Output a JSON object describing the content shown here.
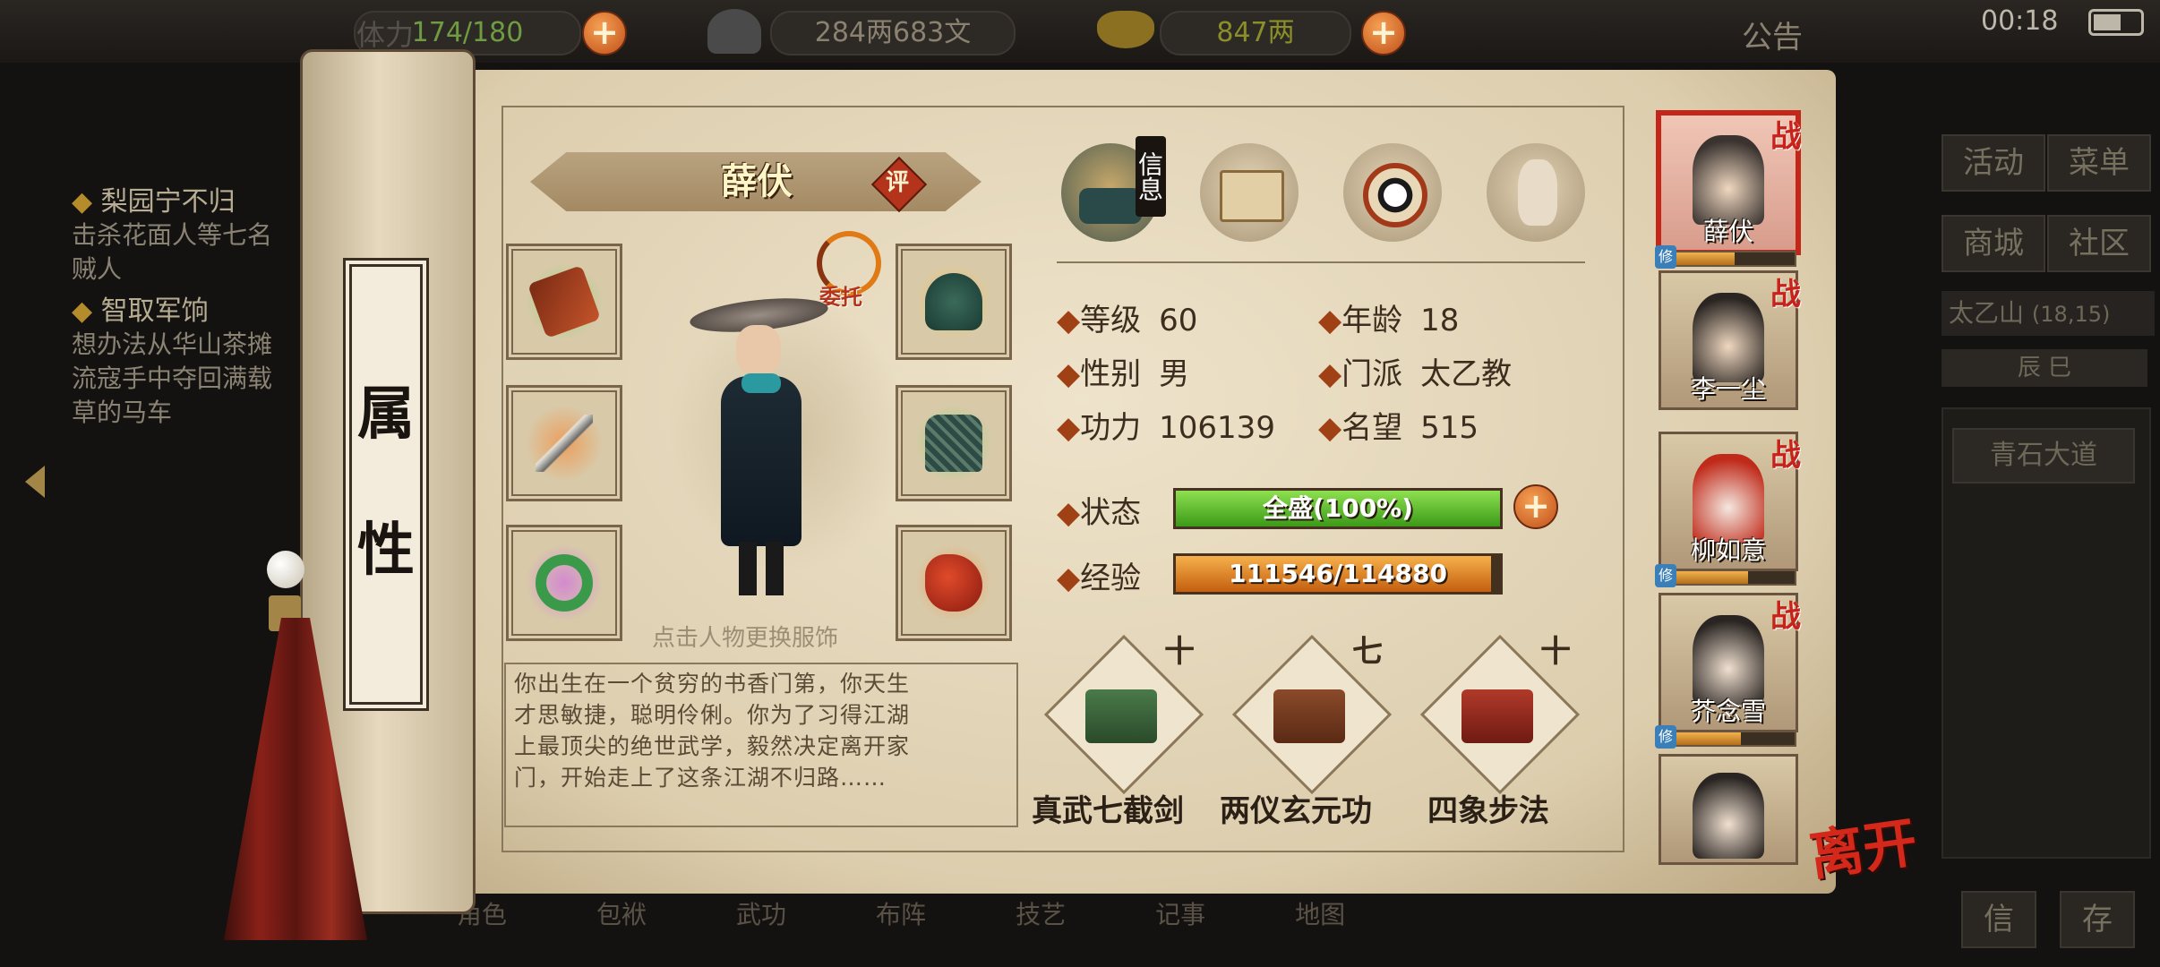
{
  "topbar": {
    "stamina_label": "体力",
    "stamina_value": "174/180",
    "money_value": "284两683文",
    "gold_value": "847两",
    "notice_label": "公告",
    "time": "00:18"
  },
  "quests": [
    {
      "title": "梨园宁不归",
      "desc_lines": [
        "击杀花面人等七名",
        "贼人"
      ]
    },
    {
      "title": "智取军饷",
      "desc_lines": [
        "想办法从华山茶摊",
        "流寇手中夺回满载",
        "草的马车"
      ]
    }
  ],
  "scroll": {
    "label_top": "属",
    "label_bottom": "性"
  },
  "character": {
    "name": "薛伏",
    "rate_label": "评",
    "entrust_label": "委托",
    "hint": "点击人物更换服饰",
    "bio_lines": [
      "你出生在一个贫穷的书香门第，你天生",
      "才思敏捷，聪明伶俐。你为了习得江湖",
      "上最顶尖的绝世武学，毅然决定离开家",
      "门，开始走上了这条江湖不归路……"
    ]
  },
  "tabs": {
    "info_label": "信息"
  },
  "stats": {
    "level_label": "等级",
    "level": "60",
    "age_label": "年龄",
    "age": "18",
    "gender_label": "性别",
    "gender": "男",
    "sect_label": "门派",
    "sect": "太乙教",
    "power_label": "功力",
    "power": "106139",
    "fame_label": "名望",
    "fame": "515",
    "status_label": "状态",
    "status_text": "全盛(100%)",
    "status_fraction": 1.0,
    "exp_label": "经验",
    "exp_text": "111546/114880",
    "exp_fraction": 0.971
  },
  "skills": [
    {
      "name": "真武七截剑",
      "level": "十"
    },
    {
      "name": "两仪玄元功",
      "level": "七"
    },
    {
      "name": "四象步法",
      "level": "十"
    }
  ],
  "party": [
    {
      "name": "薛伏",
      "tag": "战",
      "xiu_tag": "修",
      "xiu_fraction": 0.55
    },
    {
      "name": "李一尘",
      "tag": "战"
    },
    {
      "name": "柳如意",
      "tag": "战",
      "xiu_tag": "修",
      "xiu_fraction": 0.65
    },
    {
      "name": "芥念雪",
      "tag": "战",
      "xiu_tag": "修",
      "xiu_fraction": 0.6
    },
    {
      "name": ""
    }
  ],
  "leave_label": "离开",
  "sidebar": {
    "activity": "活动",
    "menu": "菜单",
    "mall": "商城",
    "community": "社区",
    "location": "太乙山",
    "coords": "(18,15)",
    "time_period": "辰 巳",
    "place": "青石大道",
    "btn_a": "信",
    "btn_b": "存"
  },
  "bottom_nav": [
    "角色",
    "包袱",
    "武功",
    "布阵",
    "技艺",
    "记事",
    "地图"
  ],
  "colors": {
    "accent_red": "#c4261a",
    "hp_green": "#5fbf2a",
    "exp_orange": "#e07a14",
    "parchment": "#e6d9bd"
  }
}
